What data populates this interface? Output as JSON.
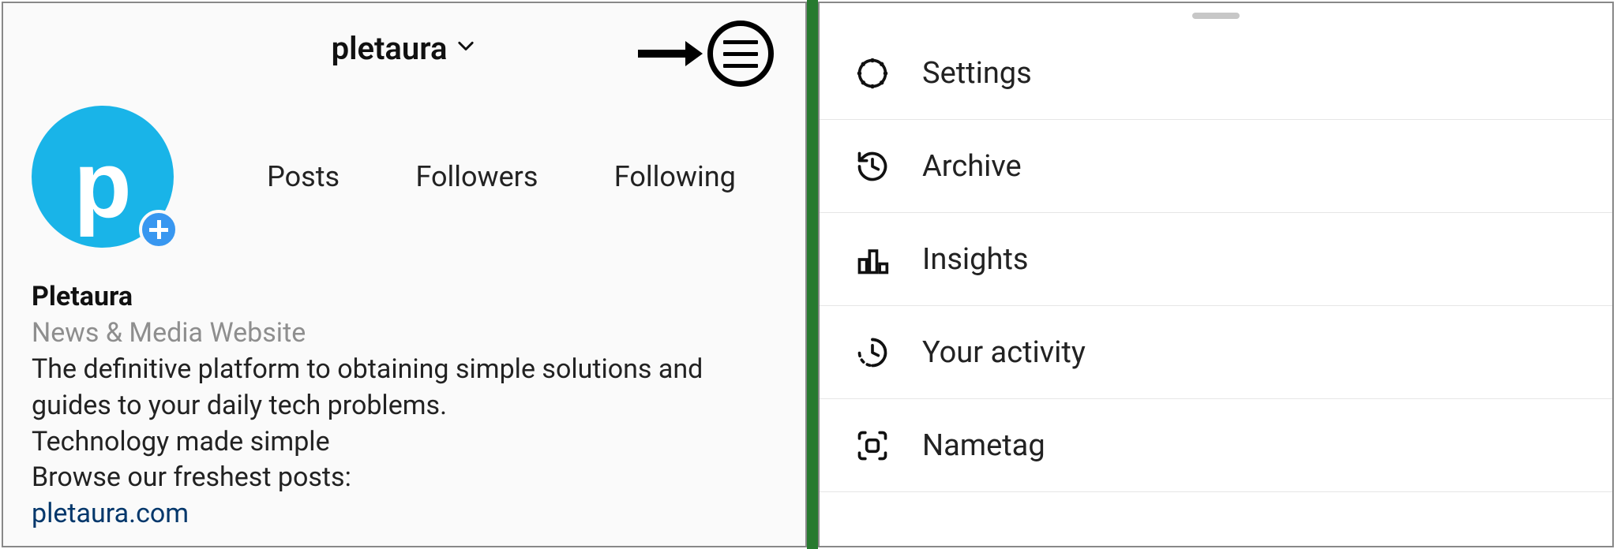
{
  "profile": {
    "username": "pletaura",
    "avatar_letter": "p",
    "stats": {
      "posts_label": "Posts",
      "followers_label": "Followers",
      "following_label": "Following"
    },
    "bio": {
      "name": "Pletaura",
      "category": "News & Media Website",
      "line1": "The definitive platform to obtaining simple solutions and guides to your daily tech problems.",
      "line2": "Technology made simple",
      "line3": "Browse our freshest posts:",
      "link": "pletaura.com"
    }
  },
  "menu": {
    "items": [
      {
        "icon": "gear",
        "label": "Settings"
      },
      {
        "icon": "history",
        "label": "Archive"
      },
      {
        "icon": "bars",
        "label": "Insights"
      },
      {
        "icon": "activity",
        "label": "Your activity"
      },
      {
        "icon": "nametag",
        "label": "Nametag"
      }
    ]
  }
}
